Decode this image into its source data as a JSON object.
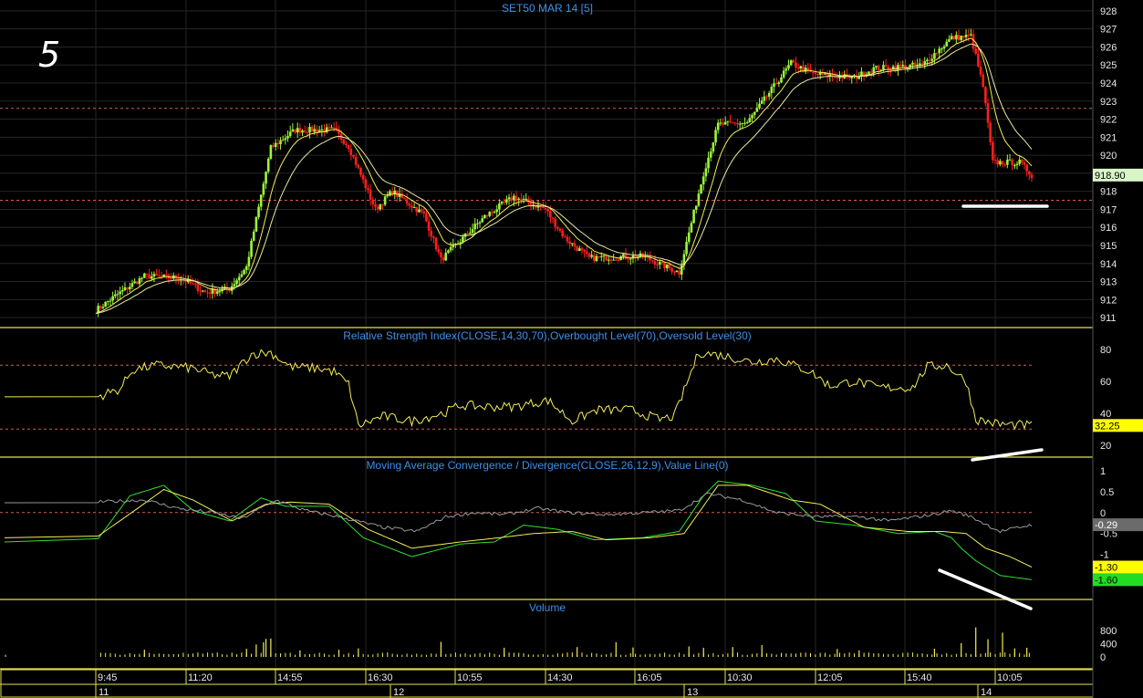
{
  "chart_label": "5",
  "colors": {
    "background": "#000000",
    "grid": "#262626",
    "frame": "#e6e24a",
    "up": "#9cf53a",
    "down": "#ff1e1e",
    "ma": "#f2ee55",
    "rsi_line": "#f2ee55",
    "ref_line": "#d85a5a",
    "macd": "#2fe02f",
    "signal": "#f2ee55",
    "histline": "#9a9a9a",
    "volume": "#f2ee55",
    "title": "#3f8ee8",
    "annotation": "#ffffff"
  },
  "chart_data": [
    {
      "type": "candlestick",
      "title": "SET50 MAR 14  [5]",
      "ylim": [
        910.5,
        928.5
      ],
      "yticks": [
        "911",
        "912",
        "913",
        "914",
        "915",
        "916",
        "917",
        "918",
        "919",
        "920",
        "921",
        "922",
        "923",
        "924",
        "925",
        "926",
        "927",
        "928"
      ],
      "reference_lines": [
        922.6,
        917.5
      ],
      "last_value_label": "918.90",
      "last_value": 918.9,
      "close_path": [
        [
          0,
          911.4
        ],
        [
          8,
          912.2
        ],
        [
          20,
          913.3
        ],
        [
          35,
          913.2
        ],
        [
          45,
          912.4
        ],
        [
          55,
          912.6
        ],
        [
          62,
          913.8
        ],
        [
          72,
          920.4
        ],
        [
          82,
          921.4
        ],
        [
          98,
          921.4
        ],
        [
          104,
          920.5
        ],
        [
          115,
          917.0
        ],
        [
          122,
          918.0
        ],
        [
          135,
          916.7
        ],
        [
          142,
          914.2
        ],
        [
          160,
          916.6
        ],
        [
          172,
          917.7
        ],
        [
          185,
          917.0
        ],
        [
          193,
          915.4
        ],
        [
          203,
          914.3
        ],
        [
          225,
          914.4
        ],
        [
          240,
          913.5
        ],
        [
          250,
          919.0
        ],
        [
          256,
          921.7
        ],
        [
          268,
          921.8
        ],
        [
          286,
          925.1
        ],
        [
          295,
          924.5
        ],
        [
          312,
          924.3
        ],
        [
          320,
          924.8
        ],
        [
          340,
          925.0
        ],
        [
          352,
          926.5
        ],
        [
          360,
          926.6
        ],
        [
          365,
          923.8
        ],
        [
          369,
          919.6
        ],
        [
          380,
          919.6
        ],
        [
          385,
          918.9
        ]
      ],
      "bars": 385
    },
    {
      "type": "line",
      "title": "Relative Strength Index(CLOSE,14,30,70),Overbought Level(70),Oversold Level(30)",
      "ylim": [
        13,
        93
      ],
      "yticks": [
        "20",
        "40",
        "60",
        "80"
      ],
      "reference_lines": [
        70,
        30
      ],
      "last_value_label": "32.25",
      "last_value": 32.25,
      "path": [
        [
          0,
          50
        ],
        [
          10,
          55
        ],
        [
          15,
          67
        ],
        [
          25,
          70
        ],
        [
          34,
          69
        ],
        [
          40,
          68
        ],
        [
          48,
          64
        ],
        [
          55,
          63
        ],
        [
          64,
          77
        ],
        [
          72,
          78
        ],
        [
          80,
          69
        ],
        [
          92,
          68
        ],
        [
          98,
          66
        ],
        [
          104,
          58
        ],
        [
          108,
          32
        ],
        [
          118,
          38
        ],
        [
          130,
          35
        ],
        [
          143,
          40
        ],
        [
          150,
          45
        ],
        [
          160,
          44
        ],
        [
          172,
          44
        ],
        [
          186,
          48
        ],
        [
          196,
          35
        ],
        [
          206,
          42
        ],
        [
          220,
          42
        ],
        [
          232,
          36
        ],
        [
          238,
          38
        ],
        [
          248,
          78
        ],
        [
          258,
          76
        ],
        [
          270,
          72
        ],
        [
          280,
          74
        ],
        [
          294,
          66
        ],
        [
          302,
          57
        ],
        [
          312,
          60
        ],
        [
          322,
          56
        ],
        [
          336,
          56
        ],
        [
          342,
          69
        ],
        [
          350,
          70
        ],
        [
          358,
          60
        ],
        [
          362,
          36
        ],
        [
          372,
          33
        ],
        [
          385,
          32.25
        ]
      ]
    },
    {
      "type": "line",
      "title": "Moving Average Convergence / Divergence(CLOSE,26,12,9),Value Line(0)",
      "ylim": [
        -2.05,
        1.3
      ],
      "yticks": [
        "-1",
        "-0.5",
        "0",
        "0.5",
        "1"
      ],
      "reference_lines": [
        0
      ],
      "last_value_labels": [
        "-0.29",
        "-1.30",
        "-1.60"
      ],
      "series": [
        {
          "path": [
            [
              0,
              -0.7
            ],
            [
              14,
              0.4
            ],
            [
              28,
              0.65
            ],
            [
              40,
              0.05
            ],
            [
              55,
              -0.2
            ],
            [
              68,
              0.35
            ],
            [
              78,
              0.15
            ],
            [
              96,
              0.15
            ],
            [
              110,
              -0.6
            ],
            [
              130,
              -1.05
            ],
            [
              150,
              -0.75
            ],
            [
              164,
              -0.7
            ],
            [
              176,
              -0.3
            ],
            [
              190,
              -0.4
            ],
            [
              205,
              -0.65
            ],
            [
              225,
              -0.6
            ],
            [
              240,
              -0.45
            ],
            [
              250,
              0.4
            ],
            [
              256,
              0.75
            ],
            [
              270,
              0.65
            ],
            [
              284,
              0.45
            ],
            [
              296,
              -0.2
            ],
            [
              312,
              -0.3
            ],
            [
              330,
              -0.5
            ],
            [
              345,
              -0.45
            ],
            [
              352,
              -0.6
            ],
            [
              356,
              -0.85
            ],
            [
              362,
              -1.15
            ],
            [
              372,
              -1.5
            ],
            [
              385,
              -1.6
            ]
          ]
        },
        {
          "path": [
            [
              0,
              -0.6
            ],
            [
              16,
              0.05
            ],
            [
              28,
              0.55
            ],
            [
              40,
              0.3
            ],
            [
              56,
              -0.2
            ],
            [
              70,
              0.2
            ],
            [
              80,
              0.25
            ],
            [
              96,
              0.2
            ],
            [
              112,
              -0.4
            ],
            [
              130,
              -0.85
            ],
            [
              150,
              -0.7
            ],
            [
              166,
              -0.6
            ],
            [
              180,
              -0.5
            ],
            [
              196,
              -0.45
            ],
            [
              210,
              -0.65
            ],
            [
              228,
              -0.6
            ],
            [
              242,
              -0.5
            ],
            [
              256,
              0.65
            ],
            [
              268,
              0.65
            ],
            [
              286,
              0.3
            ],
            [
              298,
              0.2
            ],
            [
              316,
              -0.35
            ],
            [
              334,
              -0.45
            ],
            [
              348,
              -0.45
            ],
            [
              358,
              -0.5
            ],
            [
              366,
              -0.85
            ],
            [
              376,
              -1.05
            ],
            [
              385,
              -1.3
            ]
          ]
        },
        {
          "path": [
            [
              0,
              0.25
            ],
            [
              20,
              0.3
            ],
            [
              34,
              0.1
            ],
            [
              48,
              0.0
            ],
            [
              60,
              -0.15
            ],
            [
              74,
              0.3
            ],
            [
              86,
              0.05
            ],
            [
              100,
              -0.1
            ],
            [
              118,
              -0.35
            ],
            [
              132,
              -0.45
            ],
            [
              144,
              -0.1
            ],
            [
              156,
              0.0
            ],
            [
              168,
              -0.05
            ],
            [
              182,
              0.1
            ],
            [
              194,
              0.0
            ],
            [
              210,
              -0.05
            ],
            [
              226,
              0.0
            ],
            [
              240,
              0.05
            ],
            [
              252,
              0.45
            ],
            [
              266,
              0.3
            ],
            [
              280,
              0.0
            ],
            [
              296,
              -0.1
            ],
            [
              314,
              -0.1
            ],
            [
              326,
              -0.2
            ],
            [
              344,
              -0.05
            ],
            [
              352,
              0.05
            ],
            [
              360,
              -0.1
            ],
            [
              372,
              -0.45
            ],
            [
              385,
              -0.29
            ]
          ]
        }
      ]
    },
    {
      "type": "bar",
      "title": "Volume",
      "ylim": [
        0,
        1000
      ],
      "yticks": [
        "0",
        "400",
        "800"
      ],
      "spikes": [
        [
          20,
          220
        ],
        [
          62,
          250
        ],
        [
          66,
          380
        ],
        [
          69,
          450
        ],
        [
          70,
          550
        ],
        [
          72,
          560
        ],
        [
          84,
          200
        ],
        [
          100,
          220
        ],
        [
          108,
          260
        ],
        [
          142,
          460
        ],
        [
          168,
          280
        ],
        [
          198,
          300
        ],
        [
          214,
          450
        ],
        [
          221,
          290
        ],
        [
          244,
          320
        ],
        [
          250,
          280
        ],
        [
          262,
          300
        ],
        [
          274,
          360
        ],
        [
          305,
          240
        ],
        [
          314,
          200
        ],
        [
          345,
          250
        ],
        [
          356,
          420
        ],
        [
          362,
          900
        ],
        [
          367,
          540
        ],
        [
          373,
          740
        ],
        [
          378,
          260
        ],
        [
          383,
          280
        ]
      ],
      "baseline": [
        60,
        140
      ]
    }
  ],
  "x_axis": {
    "time_labels": [
      "9:45",
      "11:20",
      "14:55",
      "16:30",
      "10:55",
      "14:30",
      "16:05",
      "10:30",
      "12:05",
      "15:40",
      "10:05"
    ],
    "day_labels": [
      "11",
      "12",
      "13",
      "14"
    ]
  }
}
